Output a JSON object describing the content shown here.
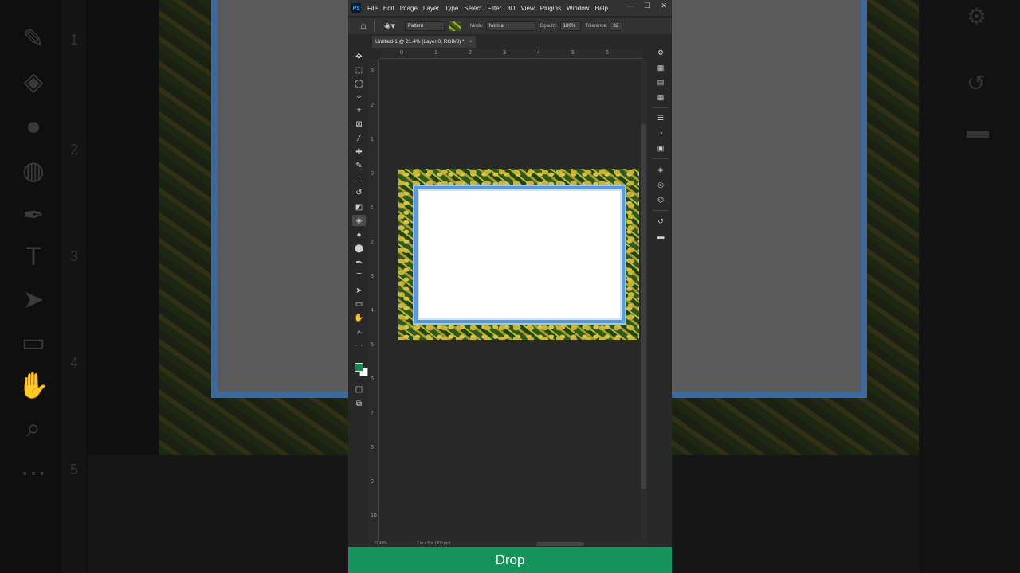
{
  "app": {
    "logo_text": "Ps",
    "menu": [
      "File",
      "Edit",
      "Image",
      "Layer",
      "Type",
      "Select",
      "Filter",
      "3D",
      "View",
      "Plugins",
      "Window",
      "Help"
    ],
    "window_controls": [
      "—",
      "☐",
      "✕"
    ]
  },
  "options_bar": {
    "fill_source": "Pattern",
    "mode_label": "Mode:",
    "mode_value": "Normal",
    "opacity_label": "Opacity:",
    "opacity_value": "100%",
    "tolerance_label": "Tolerance:",
    "tolerance_value": "32"
  },
  "document": {
    "tab_title": "Untitled-1 @ 21.4% (Layer 0, RGB/8) *",
    "tab_close": "×",
    "zoom": "21.43%",
    "doc_info": "7 in x 5 in (300 ppi)"
  },
  "rulers": {
    "horizontal": [
      "0",
      "1",
      "2",
      "3",
      "4",
      "5",
      "6"
    ],
    "vertical": [
      "3",
      "2",
      "1",
      "0",
      "1",
      "2",
      "3",
      "4",
      "5",
      "6",
      "7",
      "8",
      "9",
      "10"
    ]
  },
  "colors": {
    "foreground": "#12894e",
    "background": "#ffffff",
    "frame_inner_border": "#5a9bd6",
    "caption_bar": "#14935a"
  },
  "caption": {
    "text": "Drop"
  }
}
